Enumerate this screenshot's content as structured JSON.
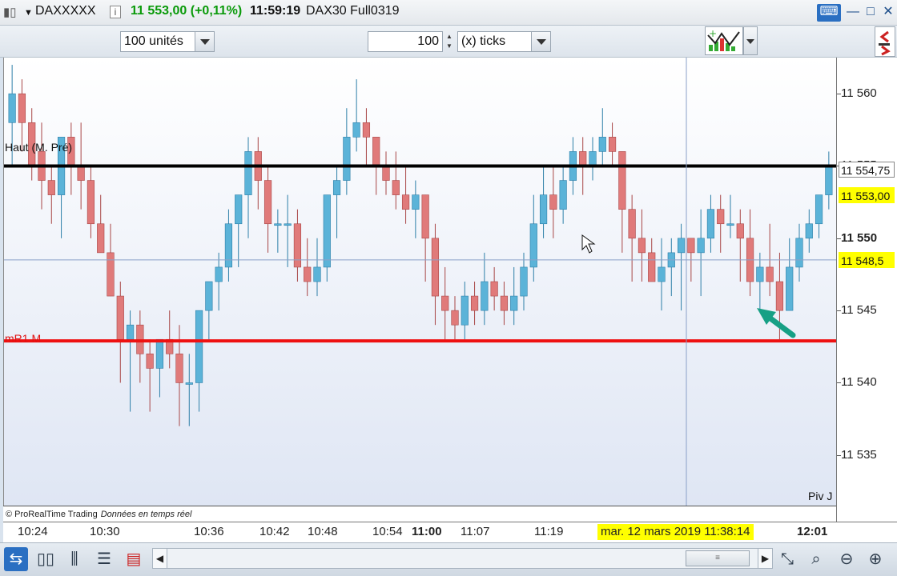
{
  "titlebar": {
    "symbol": "DAXXXXX",
    "info_icon": "i",
    "price_change": "11 553,00 (+0,11%)",
    "time": "11:59:19",
    "instrument": "DAX30 Full0319",
    "keyboard_icon": "keyboard-icon",
    "minimize": "—",
    "restore": "□",
    "close": "✕"
  },
  "toolbar": {
    "units_select": "100 unités",
    "ticks_value": "100",
    "ticks_select": "(x) ticks"
  },
  "chart": {
    "resistance_label": "Haut (M. Pré)",
    "support_label": "mR1 M",
    "pivot_label": "Piv J",
    "footer_brand": "© ProRealTime Trading",
    "footer_data": "Données en temps réel",
    "arrow_color": "#17a085"
  },
  "chart_data": {
    "type": "candlestick",
    "ylim": [
      11531.5,
      11562.5
    ],
    "ticks": [
      "11 560",
      "11 555",
      "11 550",
      "11 545",
      "11 540",
      "11 535"
    ],
    "tick_values": [
      11560,
      11555,
      11550,
      11545,
      11540,
      11535
    ],
    "lines": [
      {
        "name": "Haut (M. Pré)",
        "value": 11555.0,
        "color": "#000000"
      },
      {
        "name": "mR1 M",
        "value": 11542.9,
        "color": "#ee1111"
      },
      {
        "name": "crosshair",
        "value": 11548.5,
        "color": "#8aa0c8"
      }
    ],
    "badges": [
      {
        "label": "11 554,75",
        "value": 11554.75,
        "bg": "#ffffff",
        "border": "#888888"
      },
      {
        "label": "11 553,00",
        "value": 11553.0,
        "bg": "#ffff00",
        "border": "#ffff00"
      },
      {
        "label": "11 548,5",
        "value": 11548.5,
        "bg": "#ffff00",
        "border": "#ffff00"
      }
    ],
    "bold_tick": "11 550",
    "candles": [
      [
        11558,
        11562,
        11555,
        11560
      ],
      [
        11560,
        11561,
        11556,
        11558
      ],
      [
        11558,
        11559,
        11554,
        11555
      ],
      [
        11556,
        11558,
        11552,
        11554
      ],
      [
        11554,
        11555,
        11551,
        11553
      ],
      [
        11553,
        11557,
        11550,
        11557
      ],
      [
        11557,
        11558,
        11553,
        11555
      ],
      [
        11555,
        11558,
        11552,
        11554
      ],
      [
        11554,
        11555,
        11550,
        11551
      ],
      [
        11551,
        11553,
        11549,
        11549
      ],
      [
        11549,
        11551,
        11546,
        11546
      ],
      [
        11546,
        11547,
        11540,
        11543
      ],
      [
        11543,
        11545,
        11538,
        11544
      ],
      [
        11544,
        11545,
        11540,
        11542
      ],
      [
        11542,
        11543,
        11538,
        11541
      ],
      [
        11541,
        11543,
        11539,
        11543
      ],
      [
        11543,
        11545,
        11541,
        11542
      ],
      [
        11542,
        11544,
        11537,
        11540
      ],
      [
        11540,
        11542,
        11537,
        11540
      ],
      [
        11540,
        11545,
        11538,
        11545
      ],
      [
        11545,
        11547,
        11543,
        11547
      ],
      [
        11547,
        11549,
        11545,
        11548
      ],
      [
        11548,
        11552,
        11547,
        11551
      ],
      [
        11551,
        11553,
        11548,
        11553
      ],
      [
        11553,
        11557,
        11550,
        11556
      ],
      [
        11556,
        11557,
        11552,
        11554
      ],
      [
        11554,
        11555,
        11549,
        11551
      ],
      [
        11551,
        11552,
        11549,
        11551
      ],
      [
        11551,
        11553,
        11548,
        11551
      ],
      [
        11551,
        11552,
        11547,
        11548
      ],
      [
        11548,
        11550,
        11546,
        11547
      ],
      [
        11547,
        11550,
        11546,
        11548
      ],
      [
        11548,
        11553,
        11547,
        11553
      ],
      [
        11553,
        11555,
        11550,
        11554
      ],
      [
        11554,
        11559,
        11553,
        11557
      ],
      [
        11557,
        11561,
        11556,
        11558
      ],
      [
        11558,
        11559,
        11555,
        11557
      ],
      [
        11557,
        11557,
        11553,
        11555
      ],
      [
        11555,
        11556,
        11553,
        11554
      ],
      [
        11554,
        11556,
        11552,
        11553
      ],
      [
        11553,
        11555,
        11551,
        11552
      ],
      [
        11552,
        11554,
        11550,
        11553
      ],
      [
        11553,
        11553,
        11547,
        11550
      ],
      [
        11550,
        11551,
        11544,
        11546
      ],
      [
        11546,
        11548,
        11543,
        11545
      ],
      [
        11545,
        11546,
        11543,
        11544
      ],
      [
        11544,
        11547,
        11543,
        11546
      ],
      [
        11546,
        11547,
        11544,
        11545
      ],
      [
        11545,
        11549,
        11544,
        11547
      ],
      [
        11547,
        11548,
        11545,
        11546
      ],
      [
        11546,
        11547,
        11544,
        11545
      ],
      [
        11545,
        11548,
        11544,
        11546
      ],
      [
        11546,
        11549,
        11545,
        11548
      ],
      [
        11548,
        11553,
        11547,
        11551
      ],
      [
        11551,
        11555,
        11550,
        11553
      ],
      [
        11553,
        11555,
        11550,
        11552
      ],
      [
        11552,
        11555,
        11551,
        11554
      ],
      [
        11554,
        11557,
        11553,
        11556
      ],
      [
        11556,
        11557,
        11553,
        11555
      ],
      [
        11555,
        11557,
        11554,
        11556
      ],
      [
        11556,
        11559,
        11555,
        11557
      ],
      [
        11557,
        11558,
        11555,
        11556
      ],
      [
        11556,
        11556,
        11549,
        11552
      ],
      [
        11552,
        11553,
        11547,
        11550
      ],
      [
        11550,
        11552,
        11547,
        11549
      ],
      [
        11549,
        11550,
        11547,
        11547
      ],
      [
        11547,
        11550,
        11545,
        11548
      ],
      [
        11548,
        11550,
        11546,
        11549
      ],
      [
        11549,
        11551,
        11545,
        11550
      ],
      [
        11550,
        11550,
        11547,
        11549
      ],
      [
        11549,
        11552,
        11546,
        11550
      ],
      [
        11550,
        11553,
        11549,
        11552
      ],
      [
        11552,
        11553,
        11549,
        11551
      ],
      [
        11551,
        11553,
        11550,
        11551
      ],
      [
        11551,
        11552,
        11547,
        11550
      ],
      [
        11550,
        11552,
        11546,
        11547
      ],
      [
        11547,
        11549,
        11545,
        11548
      ],
      [
        11548,
        11551,
        11546,
        11547
      ],
      [
        11547,
        11549,
        11543,
        11545
      ],
      [
        11545,
        11550,
        11545,
        11548
      ],
      [
        11548,
        11551,
        11547,
        11550
      ],
      [
        11550,
        11552,
        11549,
        11551
      ],
      [
        11551,
        11553,
        11550,
        11553
      ],
      [
        11553,
        11556,
        11552,
        11555
      ]
    ]
  },
  "time_axis": {
    "labels": [
      "10:24",
      "10:30",
      "10:36",
      "10:42",
      "10:48",
      "10:54",
      "11:00",
      "11:07",
      "11:19",
      "12:01"
    ],
    "bold_labels": [
      "11:00",
      "12:01"
    ],
    "cursor_badge": "mar. 12 mars 2019 11:38:14"
  },
  "bottombar": {
    "scroll_thumb": "≡",
    "scroll_left": "◀",
    "scroll_right": "▶"
  }
}
